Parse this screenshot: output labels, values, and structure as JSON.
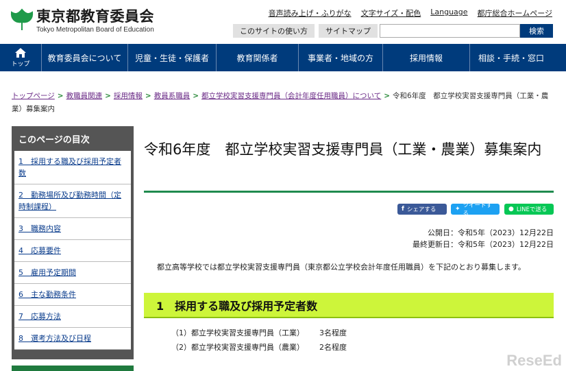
{
  "header": {
    "logo_ja": "東京都教育委員会",
    "logo_en": "Tokyo Metropolitan Board of Education",
    "util_links": [
      "音声読み上げ・ふりがな",
      "文字サイズ・配色",
      "Language",
      "都庁総合ホームページ"
    ],
    "site_usage_label": "このサイトの使い方",
    "sitemap_label": "サイトマップ",
    "search_placeholder": "",
    "search_button": "検索"
  },
  "gnav": {
    "home_label": "トップ",
    "items": [
      "教育委員会について",
      "児童・生徒・保護者",
      "教育関係者",
      "事業者・地域の方",
      "採用情報",
      "相談・手続・窓口"
    ]
  },
  "breadcrumb": {
    "links": [
      "トップページ",
      "教職員関連",
      "採用情報",
      "教員系職員",
      "都立学校実習支援専門員（会計年度任用職員）について"
    ],
    "current": "令和6年度　都立学校実習支援専門員（工業・農業）募集案内"
  },
  "toc": {
    "title": "このページの目次",
    "items": [
      "1　採用する職及び採用予定者数",
      "2　勤務場所及び勤務時間（定時制課程）",
      "3　職務内容",
      "4　応募要件",
      "5　雇用予定期間",
      "6　主な勤務条件",
      "7　応募方法",
      "8　選考方法及び日程"
    ]
  },
  "main": {
    "title": "令和6年度　都立学校実習支援専門員（工業・農業）募集案内",
    "share": {
      "facebook": "シェアする",
      "twitter": "ツイートする",
      "line": "LINEで送る"
    },
    "published": "公開日：令和5年（2023）12月22日",
    "updated": "最終更新日：令和5年（2023）12月22日",
    "intro": "都立高等学校では都立学校実習支援専門員（東京都公立学校会計年度任用職員）を下記のとおり募集します。",
    "section1_heading": "1　採用する職及び採用予定者数",
    "positions": [
      {
        "label": "（1）都立学校実習支援専門員（工業）",
        "count": "3名程度"
      },
      {
        "label": "（2）都立学校実習支援専門員（農業）",
        "count": "2名程度"
      }
    ]
  },
  "watermark": "ReseEd",
  "colors": {
    "nav_blue": "#003b7c",
    "accent_green": "#1f8a4e",
    "section_lime": "#cdf53a"
  }
}
